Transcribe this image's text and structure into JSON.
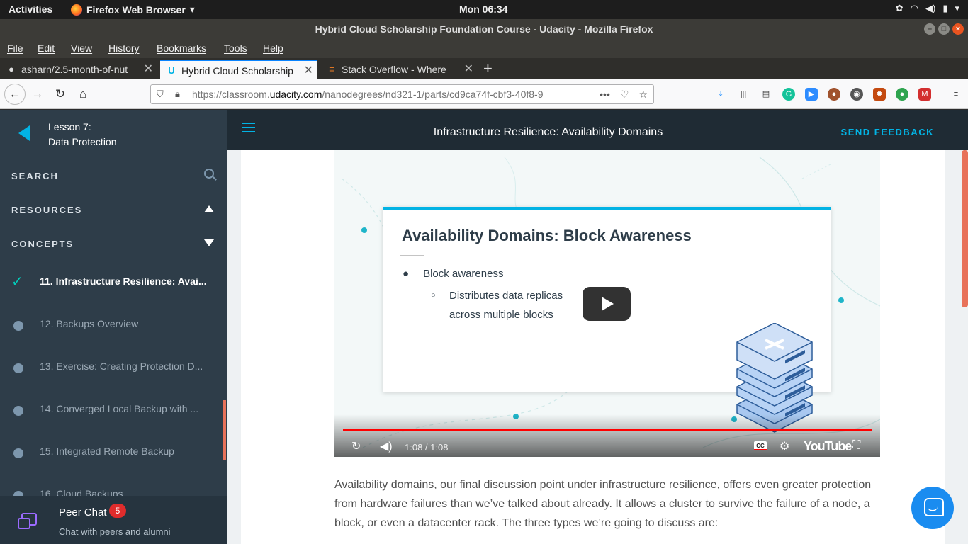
{
  "os": {
    "activities": "Activities",
    "app_name": "Firefox Web Browser",
    "clock": "Mon 06:34"
  },
  "window": {
    "title": "Hybrid Cloud Scholarship Foundation Course - Udacity - Mozilla Firefox"
  },
  "menu": [
    "File",
    "Edit",
    "View",
    "History",
    "Bookmarks",
    "Tools",
    "Help"
  ],
  "tabs": [
    {
      "label": "asharn/2.5-month-of-nut",
      "icon": "github-icon"
    },
    {
      "label": "Hybrid Cloud Scholarship",
      "icon": "udacity-icon"
    },
    {
      "label": "Stack Overflow - Where",
      "icon": "stackoverflow-icon"
    }
  ],
  "url": {
    "prefix": "https://classroom.",
    "host": "udacity.com",
    "path": "/nanodegrees/nd321-1/parts/cd9ca74f-cbf3-40f8-9"
  },
  "sidebar": {
    "lesson_number": "Lesson 7:",
    "lesson_title": "Data Protection",
    "search_label": "SEARCH",
    "resources_label": "RESOURCES",
    "concepts_label": "CONCEPTS",
    "concepts": [
      {
        "label": "11. Infrastructure Resilience: Avai...",
        "done": true
      },
      {
        "label": "12. Backups Overview",
        "done": false
      },
      {
        "label": "13. Exercise: Creating Protection D...",
        "done": false
      },
      {
        "label": "14. Converged Local Backup with ...",
        "done": false
      },
      {
        "label": "15. Integrated Remote Backup",
        "done": false
      },
      {
        "label": "16. Cloud Backups",
        "done": false
      }
    ],
    "peer_chat": {
      "title": "Peer Chat",
      "badge": "5",
      "subtitle": "Chat with peers and alumni"
    }
  },
  "header": {
    "title": "Infrastructure Resilience: Availability Domains",
    "feedback": "SEND FEEDBACK"
  },
  "video": {
    "slide_title": "Availability Domains: Block Awareness",
    "bullet": "Block awareness",
    "sub_bullet": "Distributes data replicas across multiple blocks",
    "time": "1:08 / 1:08",
    "youtube": "YouTube",
    "cc": "CC"
  },
  "body": {
    "paragraph": "Availability domains, our final discussion point under infrastructure resilience, offers even greater protection from hardware failures than we’ve talked about already. It allows a cluster to survive the failure of a node, a block, or even a datacenter rack. The three types we’re going to discuss are:"
  },
  "colors": {
    "accent": "#02b3e4",
    "sidebar_bg": "#2e3d49",
    "progress": "#ff0000",
    "check": "#02ccba"
  }
}
